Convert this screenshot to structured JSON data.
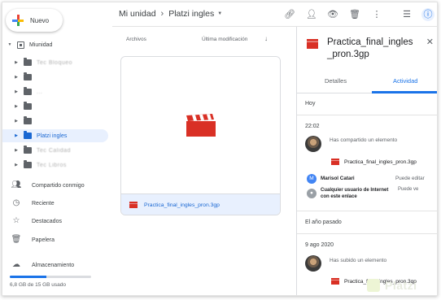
{
  "sidebar": {
    "new_label": "Nuevo",
    "my_drive": "Miunidad",
    "folders": [
      {
        "label": "Tec Bloqueo"
      },
      {
        "label": ""
      },
      {
        "label": "..."
      },
      {
        "label": ""
      },
      {
        "label": ""
      },
      {
        "label": "Platzi ingles",
        "active": true
      },
      {
        "label": "Tec Calidad"
      },
      {
        "label": "Tec Libros"
      }
    ],
    "nav": [
      {
        "label": "Compartido conmigo",
        "icon": "shared-icon"
      },
      {
        "label": "Reciente",
        "icon": "clock-icon"
      },
      {
        "label": "Destacados",
        "icon": "star-icon"
      },
      {
        "label": "Papelera",
        "icon": "trash-icon"
      },
      {
        "label": "Almacenamiento",
        "icon": "cloud-icon"
      }
    ],
    "storage": {
      "text": "6,8 GB de 15 GB usado",
      "fraction": 0.45
    }
  },
  "header": {
    "crumb_root": "Mi unidad",
    "crumb_current": "Platzi ingles",
    "icons": [
      "link-icon",
      "add-person-icon",
      "preview-icon",
      "trash-icon",
      "more-vert-icon",
      "list-view-icon",
      "info-icon"
    ]
  },
  "list": {
    "column_name": "Archivos",
    "column_sort": "Última modificación",
    "file_name": "Practica_final_ingles_pron.3gp"
  },
  "panel": {
    "title": "Practica_final_ingles _pron.3gp",
    "tabs": {
      "details": "Detalles",
      "activity": "Actividad"
    },
    "today": "Hoy",
    "time1": "22:02",
    "action1": "Has compartido un elemento",
    "file1": "Practica_final_ingles_pron.3gp",
    "users": [
      {
        "initial": "M",
        "name": "Marisol Catari",
        "role": "Puede editar",
        "color": "#4285f4"
      },
      {
        "initial": "",
        "name": "Cualquier usuario de Internet con este enlace",
        "role": "Puede ve",
        "color": "#9aa0a6"
      }
    ],
    "last_year": "El año pasado",
    "date2": "9 ago 2020",
    "action2": "Has subido un elemento",
    "file2": "Practica_final_ingles_pron.3gp"
  },
  "colors": {
    "accent": "#1a73e8",
    "video_red": "#d93025"
  },
  "watermark": "Platzi"
}
